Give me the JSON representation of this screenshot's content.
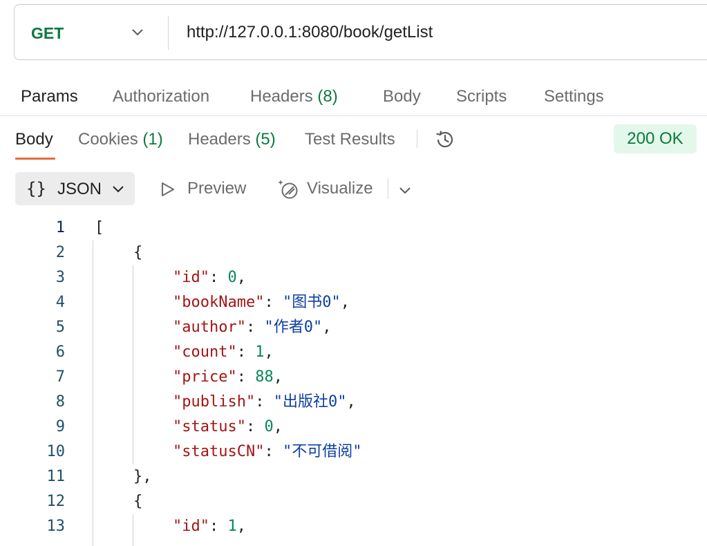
{
  "request": {
    "method": "GET",
    "url": "http://127.0.0.1:8080/book/getList"
  },
  "request_tabs": [
    {
      "label": "Params",
      "count": "",
      "active": true
    },
    {
      "label": "Authorization",
      "count": "",
      "active": false
    },
    {
      "label": "Headers",
      "count": "(8)",
      "active": false
    },
    {
      "label": "Body",
      "count": "",
      "active": false
    },
    {
      "label": "Scripts",
      "count": "",
      "active": false
    },
    {
      "label": "Settings",
      "count": "",
      "active": false
    }
  ],
  "response_tabs": [
    {
      "label": "Body",
      "count": "",
      "active": true
    },
    {
      "label": "Cookies",
      "count": "(1)",
      "active": false
    },
    {
      "label": "Headers",
      "count": "(5)",
      "active": false
    },
    {
      "label": "Test Results",
      "count": "",
      "active": false
    }
  ],
  "status": "200 OK",
  "toolbar": {
    "format_icon": "{}",
    "format_label": "JSON",
    "preview_label": "Preview",
    "visualize_label": "Visualize"
  },
  "icons": [
    "chevron-down-icon",
    "history-icon",
    "play-outline-icon",
    "visualize-sparkle-icon"
  ],
  "colors": {
    "method_green": "#0b7a3d",
    "active_underline": "#e86a3c",
    "status_bg": "#e3f7ea",
    "json_key": "#a31515",
    "json_string": "#0c3ea3",
    "json_number": "#098658"
  },
  "code_lines": [
    {
      "n": "1",
      "indent": 0,
      "parts": [
        {
          "t": "p",
          "v": "["
        }
      ]
    },
    {
      "n": "2",
      "indent": 1,
      "parts": [
        {
          "t": "p",
          "v": "{"
        }
      ]
    },
    {
      "n": "3",
      "indent": 2,
      "parts": [
        {
          "t": "k",
          "v": "\"id\""
        },
        {
          "t": "p",
          "v": ": "
        },
        {
          "t": "n",
          "v": "0"
        },
        {
          "t": "p",
          "v": ","
        }
      ]
    },
    {
      "n": "4",
      "indent": 2,
      "parts": [
        {
          "t": "k",
          "v": "\"bookName\""
        },
        {
          "t": "p",
          "v": ": "
        },
        {
          "t": "s",
          "v": "\"图书0\""
        },
        {
          "t": "p",
          "v": ","
        }
      ]
    },
    {
      "n": "5",
      "indent": 2,
      "parts": [
        {
          "t": "k",
          "v": "\"author\""
        },
        {
          "t": "p",
          "v": ": "
        },
        {
          "t": "s",
          "v": "\"作者0\""
        },
        {
          "t": "p",
          "v": ","
        }
      ]
    },
    {
      "n": "6",
      "indent": 2,
      "parts": [
        {
          "t": "k",
          "v": "\"count\""
        },
        {
          "t": "p",
          "v": ": "
        },
        {
          "t": "n",
          "v": "1"
        },
        {
          "t": "p",
          "v": ","
        }
      ]
    },
    {
      "n": "7",
      "indent": 2,
      "parts": [
        {
          "t": "k",
          "v": "\"price\""
        },
        {
          "t": "p",
          "v": ": "
        },
        {
          "t": "n",
          "v": "88"
        },
        {
          "t": "p",
          "v": ","
        }
      ]
    },
    {
      "n": "8",
      "indent": 2,
      "parts": [
        {
          "t": "k",
          "v": "\"publish\""
        },
        {
          "t": "p",
          "v": ": "
        },
        {
          "t": "s",
          "v": "\"出版社0\""
        },
        {
          "t": "p",
          "v": ","
        }
      ]
    },
    {
      "n": "9",
      "indent": 2,
      "parts": [
        {
          "t": "k",
          "v": "\"status\""
        },
        {
          "t": "p",
          "v": ": "
        },
        {
          "t": "n",
          "v": "0"
        },
        {
          "t": "p",
          "v": ","
        }
      ]
    },
    {
      "n": "10",
      "indent": 2,
      "parts": [
        {
          "t": "k",
          "v": "\"statusCN\""
        },
        {
          "t": "p",
          "v": ": "
        },
        {
          "t": "s",
          "v": "\"不可借阅\""
        }
      ]
    },
    {
      "n": "11",
      "indent": 1,
      "parts": [
        {
          "t": "p",
          "v": "},"
        }
      ]
    },
    {
      "n": "12",
      "indent": 1,
      "parts": [
        {
          "t": "p",
          "v": "{"
        }
      ]
    },
    {
      "n": "13",
      "indent": 2,
      "parts": [
        {
          "t": "k",
          "v": "\"id\""
        },
        {
          "t": "p",
          "v": ": "
        },
        {
          "t": "n",
          "v": "1"
        },
        {
          "t": "p",
          "v": ","
        }
      ]
    }
  ]
}
